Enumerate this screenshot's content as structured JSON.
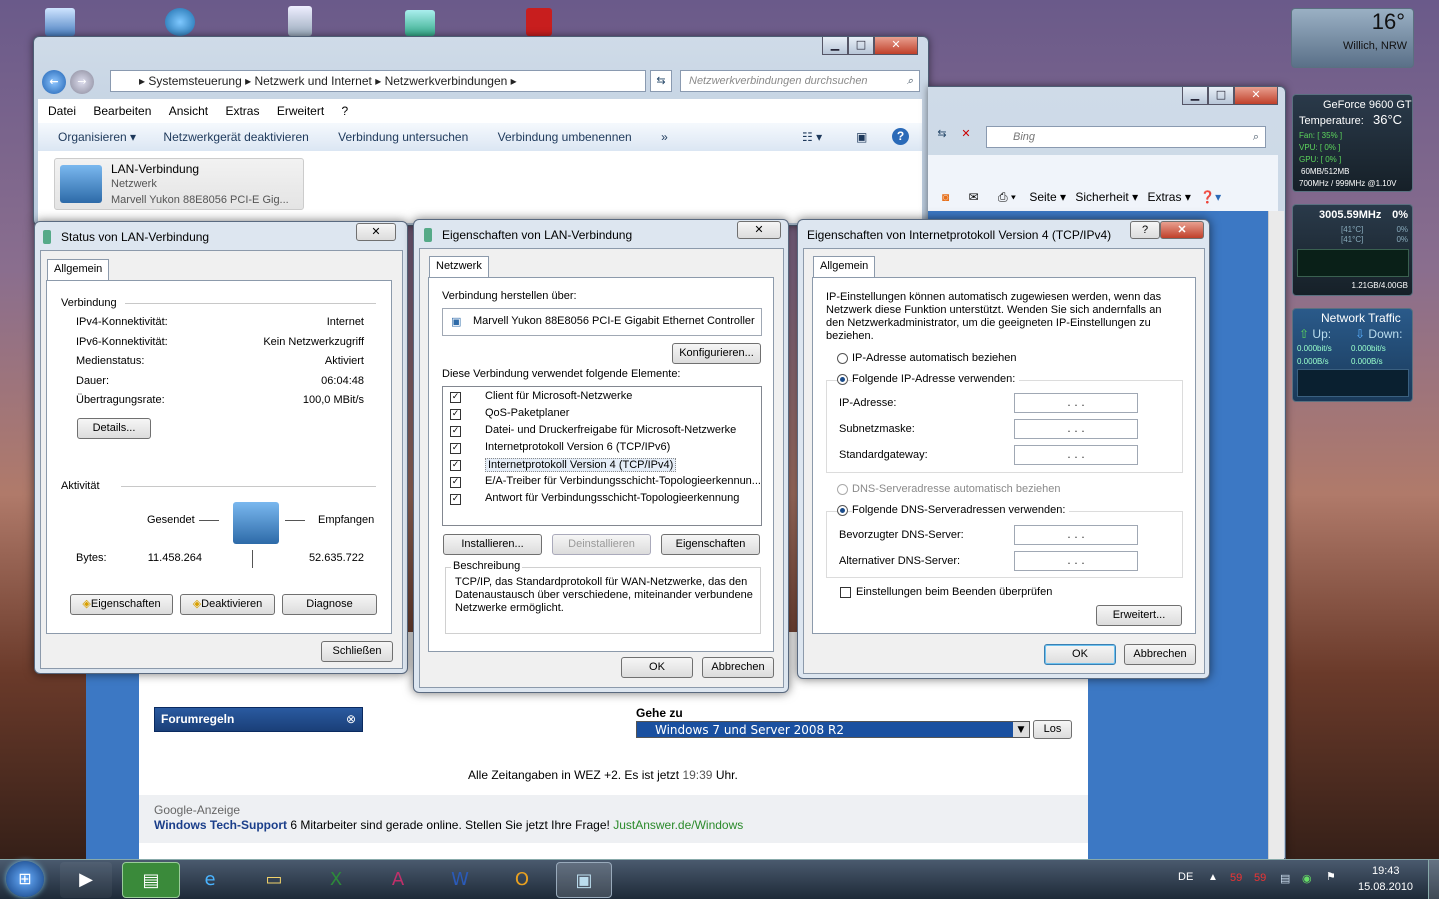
{
  "explorer": {
    "breadcrumb": [
      "Systemsteuerung",
      "Netzwerk und Internet",
      "Netzwerkverbindungen"
    ],
    "search_placeholder": "Netzwerkverbindungen durchsuchen",
    "menu": [
      "Datei",
      "Bearbeiten",
      "Ansicht",
      "Extras",
      "Erweitert",
      "?"
    ],
    "toolbar": [
      "Organisieren",
      "Netzwerkgerät deaktivieren",
      "Verbindung untersuchen",
      "Verbindung umbenennen",
      "»"
    ],
    "item": {
      "name": "LAN-Verbindung",
      "type": "Netzwerk",
      "device": "Marvell Yukon 88E8056 PCI-E Gig..."
    }
  },
  "ie": {
    "search_placeholder": "Bing",
    "cmd": [
      "Seite",
      "Sicherheit",
      "Extras"
    ]
  },
  "status": {
    "title": "Status von LAN-Verbindung",
    "tab": "Allgemein",
    "section1": "Verbindung",
    "rows": [
      {
        "k": "IPv4-Konnektivität:",
        "v": "Internet"
      },
      {
        "k": "IPv6-Konnektivität:",
        "v": "Kein Netzwerkzugriff"
      },
      {
        "k": "Medienstatus:",
        "v": "Aktiviert"
      },
      {
        "k": "Dauer:",
        "v": "06:04:48"
      },
      {
        "k": "Übertragungsrate:",
        "v": "100,0 MBit/s"
      }
    ],
    "details": "Details...",
    "section2": "Aktivität",
    "sent": "Gesendet",
    "received": "Empfangen",
    "bytes_label": "Bytes:",
    "bytes_sent": "11.458.264",
    "bytes_recv": "52.635.722",
    "btn_props": "Eigenschaften",
    "btn_deact": "Deaktivieren",
    "btn_diag": "Diagnose",
    "btn_close": "Schließen"
  },
  "props": {
    "title": "Eigenschaften von LAN-Verbindung",
    "tab": "Netzwerk",
    "connect_via": "Verbindung herstellen über:",
    "adapter": "Marvell Yukon 88E8056 PCI-E Gigabit Ethernet Controller",
    "configure": "Konfigurieren...",
    "uses": "Diese Verbindung verwendet folgende Elemente:",
    "items": [
      "Client für Microsoft-Netzwerke",
      "QoS-Paketplaner",
      "Datei- und Druckerfreigabe für Microsoft-Netzwerke",
      "Internetprotokoll Version 6 (TCP/IPv6)",
      "Internetprotokoll Version 4 (TCP/IPv4)",
      "E/A-Treiber für Verbindungsschicht-Topologieerkennun...",
      "Antwort für Verbindungsschicht-Topologieerkennung"
    ],
    "install": "Installieren...",
    "uninstall": "Deinstallieren",
    "properties": "Eigenschaften",
    "desc_title": "Beschreibung",
    "desc": "TCP/IP, das Standardprotokoll für WAN-Netzwerke, das den Datenaustausch über verschiedene, miteinander verbundene Netzwerke ermöglicht.",
    "ok": "OK",
    "cancel": "Abbrechen"
  },
  "ipv4": {
    "title": "Eigenschaften von Internetprotokoll Version 4 (TCP/IPv4)",
    "tab": "Allgemein",
    "intro": "IP-Einstellungen können automatisch zugewiesen werden, wenn das Netzwerk diese Funktion unterstützt. Wenden Sie sich andernfalls an den Netzwerkadministrator, um die geeigneten IP-Einstellungen zu beziehen.",
    "auto_ip": "IP-Adresse automatisch beziehen",
    "manual_ip": "Folgende IP-Adresse verwenden:",
    "ip": "IP-Adresse:",
    "subnet": "Subnetzmaske:",
    "gateway": "Standardgateway:",
    "auto_dns": "DNS-Serveradresse automatisch beziehen",
    "manual_dns": "Folgende DNS-Serveradressen verwenden:",
    "pref_dns": "Bevorzugter DNS-Server:",
    "alt_dns": "Alternativer DNS-Server:",
    "validate": "Einstellungen beim Beenden überprüfen",
    "advanced": "Erweitert...",
    "ok": "OK",
    "cancel": "Abbrechen",
    "ip_dots": ". . ."
  },
  "forum": {
    "rules": "Forumregeln",
    "goto": "Gehe zu",
    "goto_value": "Windows 7 und Server 2008 R2",
    "los": "Los",
    "time_prefix": "Alle Zeitangaben in WEZ +2. Es ist jetzt",
    "time": "19:39",
    "time_suffix": "Uhr.",
    "ad_label": "Google-Anzeige",
    "ad_link": "Windows Tech-Support",
    "ad_text": "6 Mitarbeiter sind gerade online. Stellen Sie jetzt Ihre Frage!",
    "ad_url": "JustAnswer.de/Windows"
  },
  "gadgets": {
    "weather": {
      "temp": "16°",
      "place": "Willich, NRW"
    },
    "gpu": {
      "name": "GeForce 9600 GT",
      "temp_label": "Temperature:",
      "temp": "36°C",
      "fan": "Fan: [ 35% ]",
      "vpu": "VPU: [ 0% ]",
      "gpu": "GPU: [ 0% ]",
      "mem": "60MB/512MB",
      "clock": "700MHz / 999MHz @1.10V"
    },
    "cpu": {
      "freq": "3005.59MHz",
      "load": "0%",
      "c1": "[41°C]",
      "c2": "[41°C]",
      "p1": "0%",
      "p2": "0%",
      "ram": "1.21GB/4.00GB"
    },
    "net": {
      "title": "Network Traffic",
      "up": "Up:",
      "down": "Down:",
      "up1": "0.000bit/s",
      "down1": "0.000bit/s",
      "up2": "0.000B/s",
      "down2": "0.000B/s"
    }
  },
  "taskbar": {
    "lang": "DE",
    "tray1": "59",
    "tray2": "59",
    "time": "19:43",
    "date": "15.08.2010"
  }
}
